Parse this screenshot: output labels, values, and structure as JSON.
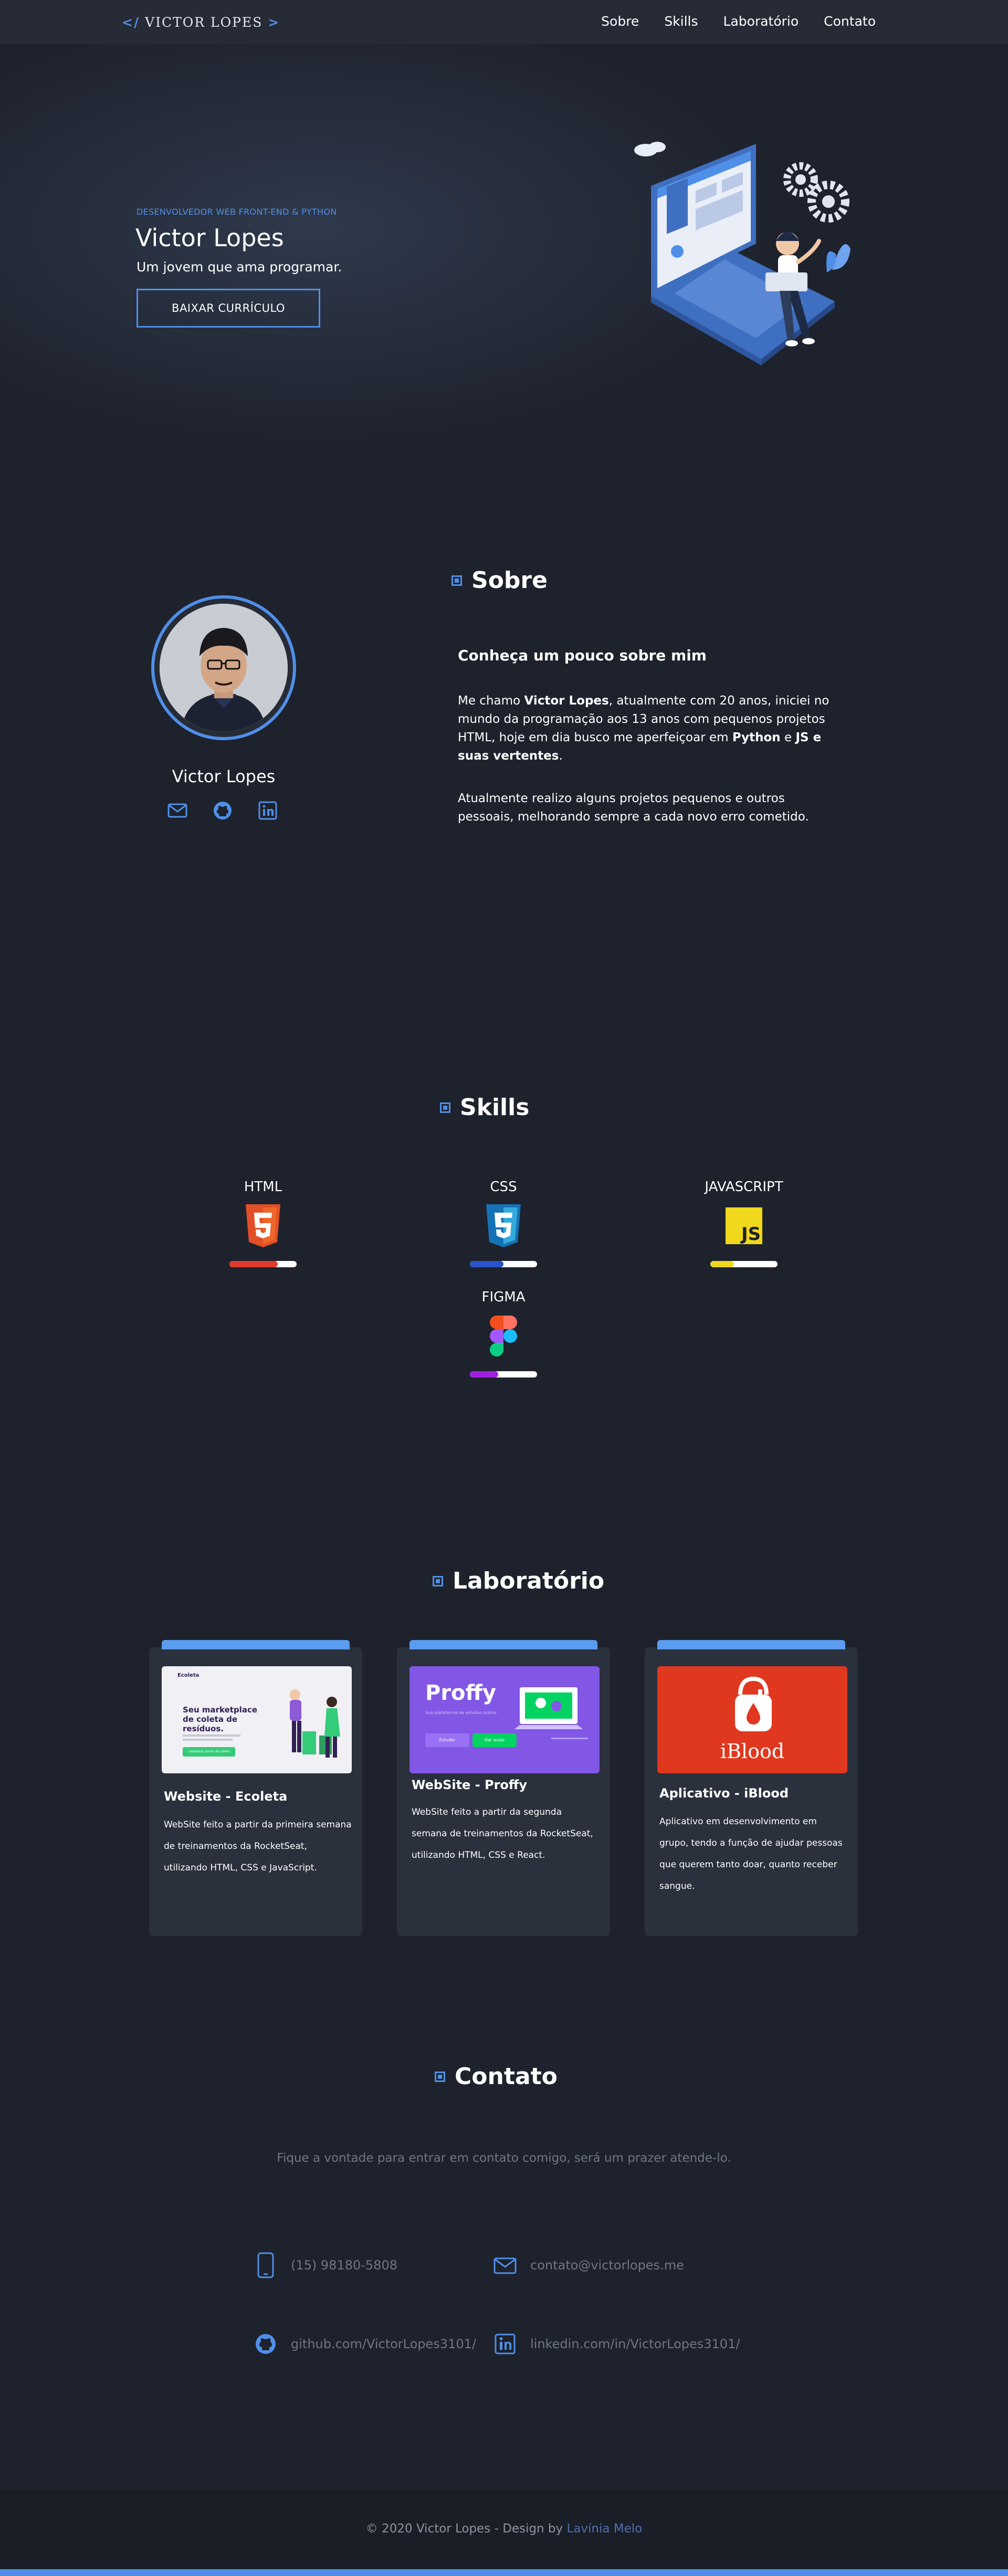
{
  "nav": {
    "logo_open": "</",
    "logo_text": "Victor Lopes",
    "logo_close": ">",
    "links": [
      "Sobre",
      "Skills",
      "Laboratório",
      "Contato"
    ]
  },
  "hero": {
    "subtitle": "DESENVOLVEDOR WEB FRONT-END & PYTHON",
    "title": "Victor Lopes",
    "description": "Um jovem que ama programar.",
    "button": "BAIXAR CURRÍCULO"
  },
  "about": {
    "section_title": "Sobre",
    "name": "Victor Lopes",
    "heading": "Conheça um pouco sobre mim",
    "p1_a": "Me chamo ",
    "p1_b": "Victor Lopes",
    "p1_c": ", atualmente com 20 anos, iniciei no mundo da programação aos 13 anos com pequenos projetos HTML, hoje em dia busco me aperfeiçoar em ",
    "p1_d": "Python",
    "p1_e": " e ",
    "p1_f": "JS e suas vertentes",
    "p1_g": ".",
    "p2": "Atualmente realizo alguns projetos pequenos e outros pessoais, melhorando sempre a cada novo erro cometido.",
    "icons": [
      "mail-icon",
      "github-icon",
      "linkedin-icon"
    ]
  },
  "skills": {
    "section_title": "Skills",
    "items": [
      {
        "label": "HTML",
        "level": 0.72,
        "color": "#e03a2c"
      },
      {
        "label": "CSS",
        "level": 0.5,
        "color": "#2a55c9"
      },
      {
        "label": "JAVASCRIPT",
        "level": 0.35,
        "color": "#f0d81c"
      },
      {
        "label": "FIGMA",
        "level": 0.42,
        "color": "#a020e0"
      }
    ]
  },
  "lab": {
    "section_title": "Laboratório",
    "cards": [
      {
        "title": "Website - Ecoleta",
        "desc": "WebSite feito a partir da primeira semana de treinamentos da RocketSeat, utilizando HTML, CSS e JavaScript.",
        "thumb_brand": "Ecoleta",
        "thumb_heading": "Seu marketplace de coleta de resíduos.",
        "thumb_button": "Cadastrar ponto de coleta"
      },
      {
        "title": "WebSite - Proffy",
        "desc": "WebSite feito a partir da segunda semana de treinamentos da RocketSeat, utilizando HTML, CSS e React.",
        "thumb_brand": "Proffy",
        "thumb_tagline": "Sua plataforma de estudos online.",
        "thumb_btn1": "Estudar",
        "thumb_btn2": "Dar aulas"
      },
      {
        "title": "Aplicativo - iBlood",
        "desc": "Aplicativo em desenvolvimento em grupo, tendo a função de ajudar pessoas que querem tanto doar, quanto receber sangue.",
        "thumb_brand": "iBlood"
      }
    ]
  },
  "contact": {
    "section_title": "Contato",
    "intro": "Fique a vontade para entrar em contato comigo, será um prazer atende-lo.",
    "phone": "(15) 98180-5808",
    "email": "contato@victorlopes.me",
    "github": "github.com/VictorLopes3101/",
    "linkedin": "linkedin.com/in/VictorLopes3101/"
  },
  "footer": {
    "text": "© 2020 Victor Lopes - Design by ",
    "designer": "Lavínia Melo"
  },
  "colors": {
    "accent": "#4f8fe8",
    "background": "#1e222c",
    "card": "#2a303c"
  }
}
